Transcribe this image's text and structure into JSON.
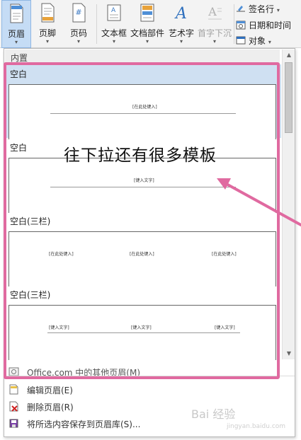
{
  "ribbon": {
    "buttons": [
      {
        "label": "页眉",
        "icon": "header-icon"
      },
      {
        "label": "页脚",
        "icon": "footer-icon"
      },
      {
        "label": "页码",
        "icon": "page-number-icon"
      },
      {
        "label": "文本框",
        "icon": "text-box-icon"
      },
      {
        "label": "文档部件",
        "icon": "quick-parts-icon"
      },
      {
        "label": "艺术字",
        "icon": "wordart-icon"
      },
      {
        "label": "首字下沉",
        "icon": "drop-cap-icon"
      }
    ],
    "small": [
      {
        "label": "签名行",
        "icon": "signature-line-icon"
      },
      {
        "label": "日期和时间",
        "icon": "date-time-icon"
      },
      {
        "label": "对象",
        "icon": "object-icon"
      }
    ],
    "arrow": "▾"
  },
  "panel": {
    "section_title": "内置",
    "templates": [
      {
        "name": "空白",
        "placeholders": [
          "[在此处键入]"
        ]
      },
      {
        "name": "空白",
        "placeholders": [
          "[键入文字]"
        ]
      },
      {
        "name": "空白(三栏)",
        "placeholders": [
          "[在此处键入]",
          "[在此处键入]",
          "[在此处键入]"
        ]
      },
      {
        "name": "空白(三栏)",
        "placeholders": [
          "[键入文字]",
          "[键入文字]",
          "[键入文字]"
        ]
      }
    ],
    "menu": [
      {
        "label": "Office.com 中的其他页眉(M)",
        "icon": "office-online-icon"
      },
      {
        "label": "编辑页眉(E)",
        "icon": "edit-header-icon"
      },
      {
        "label": "删除页眉(R)",
        "icon": "remove-header-icon"
      },
      {
        "label": "将所选内容保存到页眉库(S)...",
        "icon": "save-selection-icon"
      }
    ]
  },
  "annotation": {
    "text": "往下拉还有很多模板",
    "color": "#e06aa0"
  },
  "watermark": {
    "text": "Bai 经验",
    "sub": "jingyan.baidu.com"
  }
}
